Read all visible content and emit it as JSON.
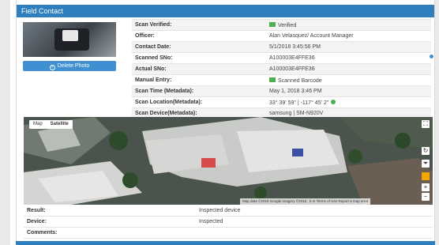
{
  "panel": {
    "title": "Field Contact"
  },
  "photo": {
    "delete_label": "Delete Photo"
  },
  "details": [
    {
      "label": "Scan Verified:",
      "value": "Verified",
      "icon": "check-icon"
    },
    {
      "label": "Officer:",
      "value": "Alan Velasquez/ Account Manager"
    },
    {
      "label": "Contact Date:",
      "value": "5/1/2018 3:45:56 PM"
    },
    {
      "label": "Scanned SNo:",
      "value": "A100003E4FFE36"
    },
    {
      "label": "Actual SNo:",
      "value": "A100003E4FFE36"
    },
    {
      "label": "Manual Entry:",
      "value": "Scanned Barcode",
      "icon": "barcode-icon"
    },
    {
      "label": "Scan Time (Metadata):",
      "value": "May 1, 2018 3:46 PM"
    },
    {
      "label": "Scan Location(Metadata):",
      "value": "33° 39' 59\" | -117° 45' 2\"",
      "icon": "location-icon"
    },
    {
      "label": "Scan Device(Metadata):",
      "value": "samsung | SM-N920V"
    }
  ],
  "map": {
    "type_options": [
      "Map",
      "Satellite"
    ],
    "selected_type": "Satellite",
    "attribution": "Map data ©2018 Google Imagery ©2018 , 5 m     Terms of Use    Report a map error",
    "zoom_in": "+",
    "zoom_out": "−"
  },
  "footer_rows": [
    {
      "label": "Result:",
      "value": "Inspected device"
    },
    {
      "label": "Device:",
      "value": "Inspected"
    },
    {
      "label": "Comments:",
      "value": ""
    }
  ],
  "colors": {
    "header": "#2f7fbf",
    "button": "#3f8fd1",
    "verified": "#4caf50"
  }
}
